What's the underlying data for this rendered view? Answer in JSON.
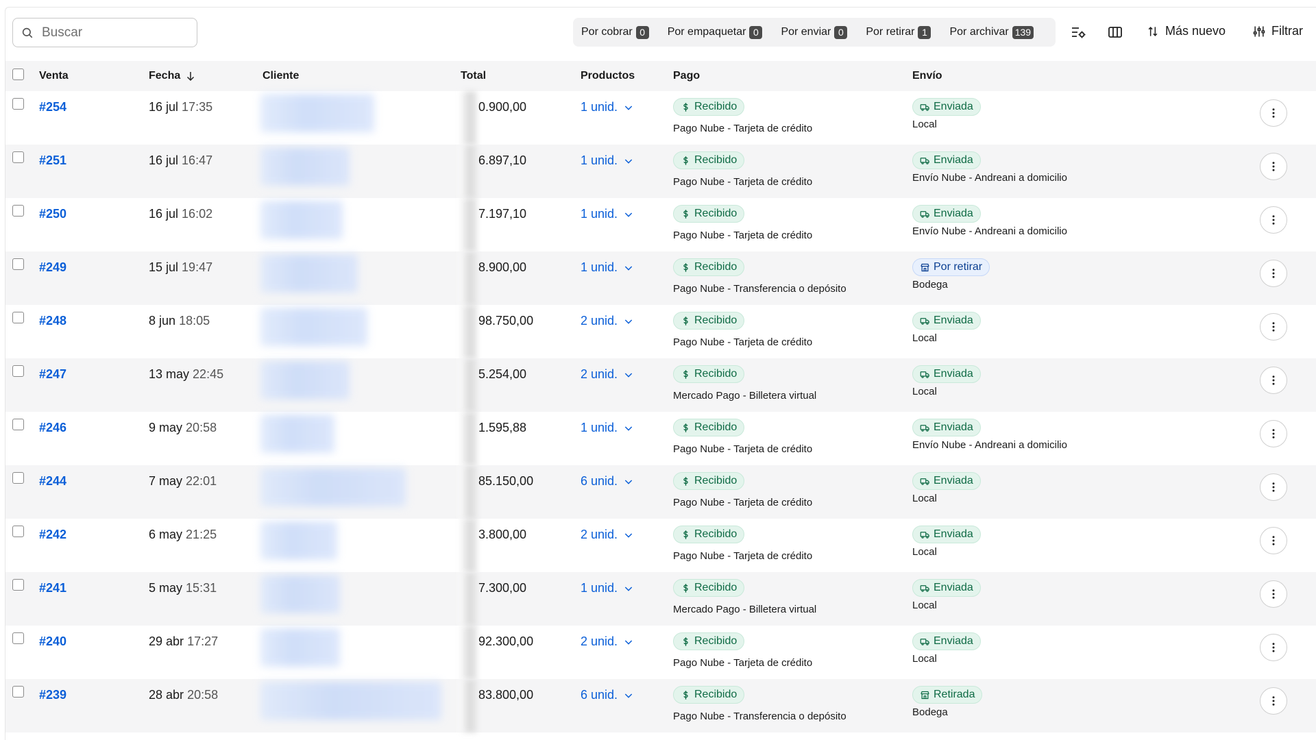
{
  "search": {
    "placeholder": "Buscar",
    "value": ""
  },
  "filters": [
    {
      "label": "Por cobrar",
      "count": "0"
    },
    {
      "label": "Por empaquetar",
      "count": "0"
    },
    {
      "label": "Por enviar",
      "count": "0"
    },
    {
      "label": "Por retirar",
      "count": "1"
    },
    {
      "label": "Por archivar",
      "count": "139"
    }
  ],
  "toolbar": {
    "sort_label": "Más nuevo",
    "filter_label": "Filtrar",
    "icons": [
      "settings-list-icon",
      "columns-icon",
      "sort-icon",
      "filter-sliders-icon"
    ]
  },
  "columns": {
    "venta": "Venta",
    "fecha": "Fecha",
    "cliente": "Cliente",
    "total": "Total",
    "productos": "Productos",
    "pago": "Pago",
    "envio": "Envío"
  },
  "colors": {
    "link": "#0b5fd8",
    "green_bg": "#e3f4ec",
    "green_text": "#0f6b45",
    "blue_bg": "#e8f0fd",
    "blue_text": "#0b3f91"
  },
  "orders": [
    {
      "id": "#254",
      "date": "16 jul",
      "time": "17:35",
      "total": "0.900,00",
      "products": "1 unid.",
      "payment_status": "Recibido",
      "payment_method": "Pago Nube - Tarjeta de crédito",
      "shipping_status": "Enviada",
      "shipping_method": "Local",
      "shipping_kind": "truck"
    },
    {
      "id": "#251",
      "date": "16 jul",
      "time": "16:47",
      "total": "6.897,10",
      "products": "1 unid.",
      "payment_status": "Recibido",
      "payment_method": "Pago Nube - Tarjeta de crédito",
      "shipping_status": "Enviada",
      "shipping_method": "Envío Nube - Andreani a domicilio",
      "shipping_kind": "truck"
    },
    {
      "id": "#250",
      "date": "16 jul",
      "time": "16:02",
      "total": "7.197,10",
      "products": "1 unid.",
      "payment_status": "Recibido",
      "payment_method": "Pago Nube - Tarjeta de crédito",
      "shipping_status": "Enviada",
      "shipping_method": "Envío Nube - Andreani a domicilio",
      "shipping_kind": "truck"
    },
    {
      "id": "#249",
      "date": "15 jul",
      "time": "19:47",
      "total": "8.900,00",
      "products": "1 unid.",
      "payment_status": "Recibido",
      "payment_method": "Pago Nube - Transferencia o depósito",
      "shipping_status": "Por retirar",
      "shipping_method": "Bodega",
      "shipping_kind": "store"
    },
    {
      "id": "#248",
      "date": "8 jun",
      "time": "18:05",
      "total": "98.750,00",
      "products": "2 unid.",
      "payment_status": "Recibido",
      "payment_method": "Pago Nube - Tarjeta de crédito",
      "shipping_status": "Enviada",
      "shipping_method": "Local",
      "shipping_kind": "truck"
    },
    {
      "id": "#247",
      "date": "13 may",
      "time": "22:45",
      "total": "5.254,00",
      "products": "2 unid.",
      "payment_status": "Recibido",
      "payment_method": "Mercado Pago - Billetera virtual",
      "shipping_status": "Enviada",
      "shipping_method": "Local",
      "shipping_kind": "truck"
    },
    {
      "id": "#246",
      "date": "9 may",
      "time": "20:58",
      "total": "1.595,88",
      "products": "1 unid.",
      "payment_status": "Recibido",
      "payment_method": "Pago Nube - Tarjeta de crédito",
      "shipping_status": "Enviada",
      "shipping_method": "Envío Nube - Andreani a domicilio",
      "shipping_kind": "truck"
    },
    {
      "id": "#244",
      "date": "7 may",
      "time": "22:01",
      "total": "85.150,00",
      "products": "6 unid.",
      "payment_status": "Recibido",
      "payment_method": "Pago Nube - Tarjeta de crédito",
      "shipping_status": "Enviada",
      "shipping_method": "Local",
      "shipping_kind": "truck"
    },
    {
      "id": "#242",
      "date": "6 may",
      "time": "21:25",
      "total": "3.800,00",
      "products": "2 unid.",
      "payment_status": "Recibido",
      "payment_method": "Pago Nube - Tarjeta de crédito",
      "shipping_status": "Enviada",
      "shipping_method": "Local",
      "shipping_kind": "truck"
    },
    {
      "id": "#241",
      "date": "5 may",
      "time": "15:31",
      "total": "7.300,00",
      "products": "1 unid.",
      "payment_status": "Recibido",
      "payment_method": "Mercado Pago - Billetera virtual",
      "shipping_status": "Enviada",
      "shipping_method": "Local",
      "shipping_kind": "truck"
    },
    {
      "id": "#240",
      "date": "29 abr",
      "time": "17:27",
      "total": "92.300,00",
      "products": "2 unid.",
      "payment_status": "Recibido",
      "payment_method": "Pago Nube - Tarjeta de crédito",
      "shipping_status": "Enviada",
      "shipping_method": "Local",
      "shipping_kind": "truck"
    },
    {
      "id": "#239",
      "date": "28 abr",
      "time": "20:58",
      "total": "83.800,00",
      "products": "6 unid.",
      "payment_status": "Recibido",
      "payment_method": "Pago Nube - Transferencia o depósito",
      "shipping_status": "Retirada",
      "shipping_method": "Bodega",
      "shipping_kind": "store"
    }
  ]
}
